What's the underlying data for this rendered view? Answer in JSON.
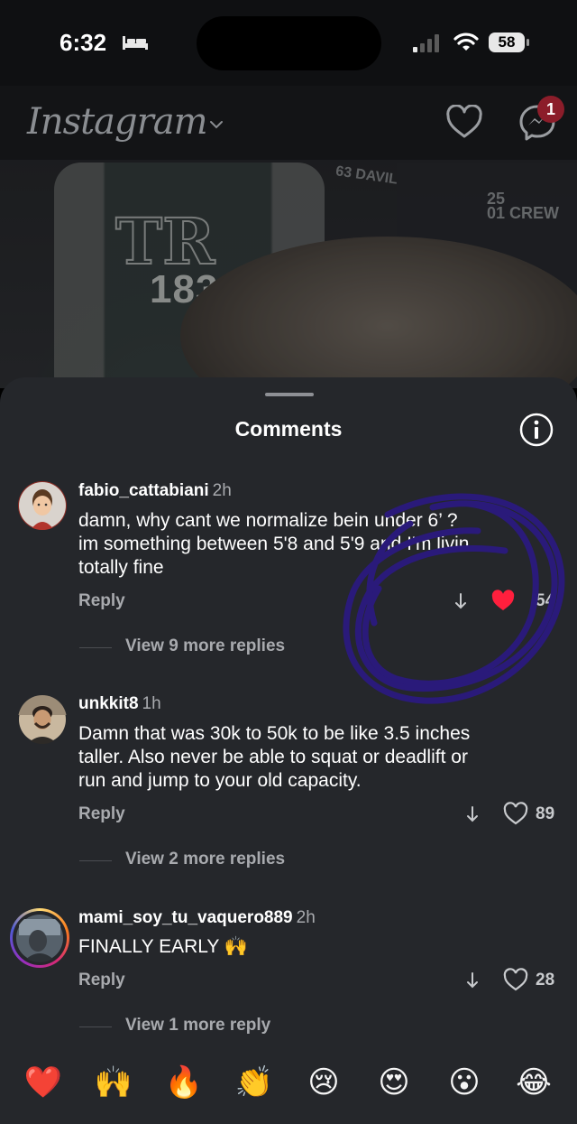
{
  "status_bar": {
    "time": "6:32",
    "battery": "58",
    "icons": [
      "sleep-bed-icon",
      "cellular-signal-icon",
      "wifi-icon",
      "battery-icon"
    ]
  },
  "header": {
    "app_name": "Instagram",
    "notification_count": "1",
    "icons": [
      "chevron-down-icon",
      "heart-icon",
      "messenger-icon"
    ]
  },
  "background_video": {
    "visible_text": [
      "183",
      "TR",
      "63 DAVIL",
      "25",
      "01 CREW"
    ]
  },
  "sheet": {
    "title": "Comments"
  },
  "comments": [
    {
      "username": "fabio_cattabiani",
      "time": "2h",
      "text_lines": [
        "damn, why cant we normalize bein   under 6’ ?",
        "im something between 5'8 and 5'9 and I'm livin",
        "totally fine"
      ],
      "reply_label": "Reply",
      "likes": "54",
      "liked": true,
      "view_replies": "View 9 more replies"
    },
    {
      "username": "unkkit8",
      "time": "1h",
      "text_lines": [
        "Damn that was 30k to 50k to be like 3.5 inches",
        "taller.  Also never be able to squat or deadlift or",
        "run and jump to your old capacity."
      ],
      "reply_label": "Reply",
      "likes": "89",
      "liked": false,
      "view_replies": "View 2 more replies"
    },
    {
      "username": "mami_soy_tu_vaquero889",
      "time": "2h",
      "text_lines": [
        "FINALLY EARLY 🙌"
      ],
      "reply_label": "Reply",
      "likes": "28",
      "liked": false,
      "view_replies": "View 1 more reply"
    }
  ],
  "emoji_bar": [
    "❤️",
    "🙌",
    "🔥",
    "👏",
    "😢",
    "😍",
    "😮",
    "😂"
  ],
  "colors": {
    "sheet_bg": "#25272b",
    "liked_heart": "#ff1f3d",
    "scribble": "#2a1a7a",
    "badge": "#8c1d2a"
  }
}
